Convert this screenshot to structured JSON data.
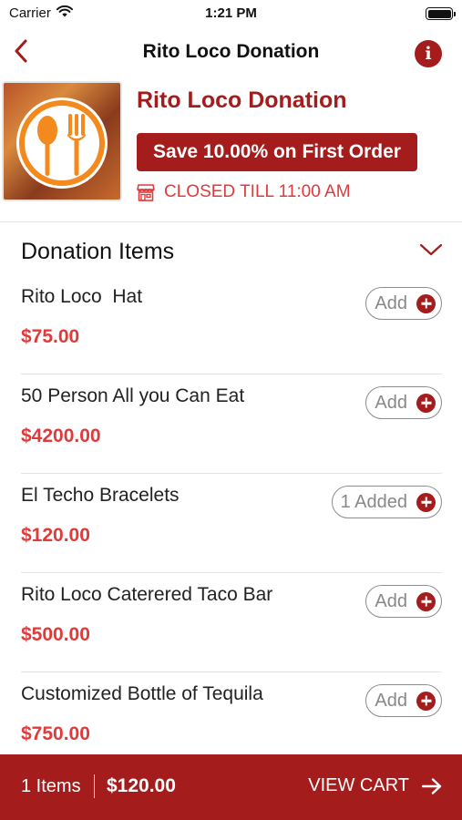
{
  "status_bar": {
    "carrier": "Carrier",
    "time": "1:21 PM"
  },
  "nav": {
    "title": "Rito Loco Donation",
    "back_icon": "chevron-left-icon",
    "info_icon": "info-icon",
    "info_glyph": "i"
  },
  "store": {
    "name": "Rito Loco Donation",
    "promo": "Save 10.00% on First Order",
    "status": "CLOSED TILL 11:00 AM",
    "status_icon": "store-icon"
  },
  "section": {
    "title": "Donation Items",
    "toggle_icon": "chevron-down-icon"
  },
  "items": [
    {
      "name": "Rito Loco  Hat",
      "price": "$75.00",
      "button_label": "Add"
    },
    {
      "name": "50 Person All you Can Eat",
      "price": "$4200.00",
      "button_label": "Add"
    },
    {
      "name": "El Techo Bracelets",
      "price": "$120.00",
      "button_label": "1 Added"
    },
    {
      "name": "Rito Loco Caterered Taco Bar",
      "price": "$500.00",
      "button_label": "Add"
    },
    {
      "name": "Customized Bottle of Tequila",
      "price": "$750.00",
      "button_label": "Add"
    }
  ],
  "cart": {
    "count": "1 Items",
    "total": "$120.00",
    "action": "VIEW CART",
    "arrow_icon": "arrow-right-icon"
  },
  "colors": {
    "brand": "#a51c1c",
    "price": "#e03a3a",
    "logo_orange": "#f28a1e"
  }
}
